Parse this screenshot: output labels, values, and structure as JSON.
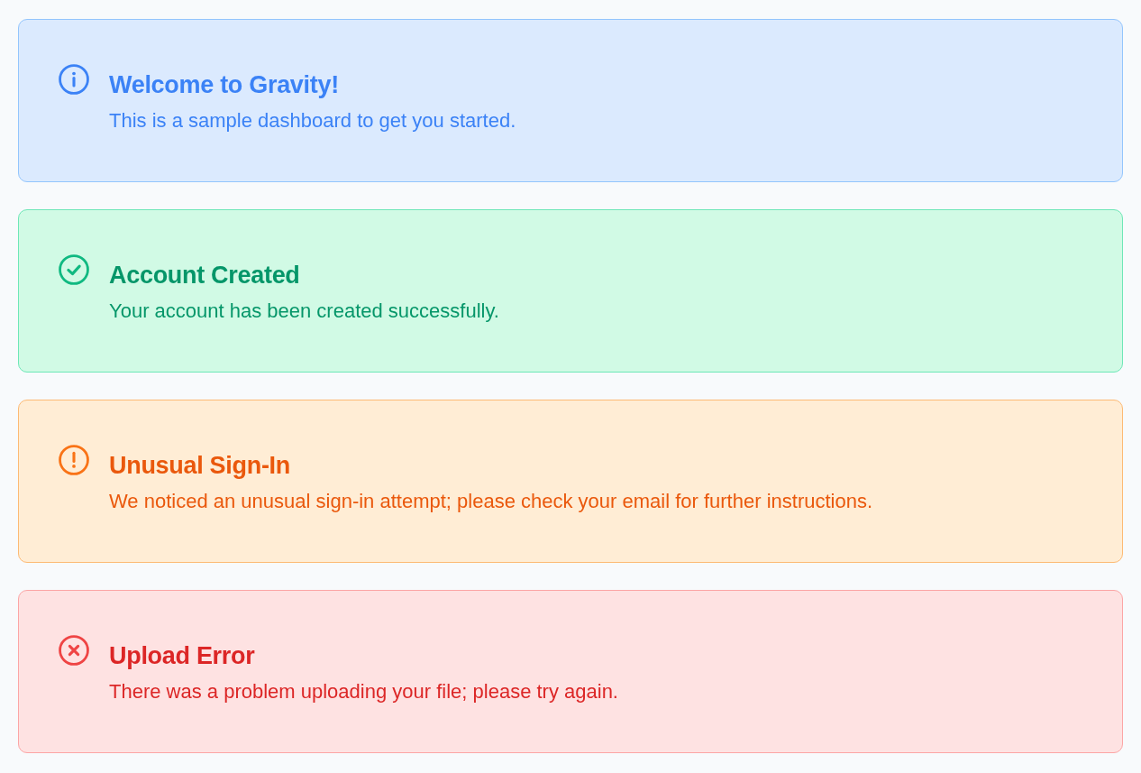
{
  "alerts": [
    {
      "kind": "info",
      "title": "Welcome to Gravity!",
      "message": "This is a sample dashboard to get you started."
    },
    {
      "kind": "success",
      "title": "Account Created",
      "message": "Your account has been created successfully."
    },
    {
      "kind": "warning",
      "title": "Unusual Sign-In",
      "message": "We noticed an unusual sign-in attempt; please check your email for further instructions."
    },
    {
      "kind": "error",
      "title": "Upload Error",
      "message": "There was a problem uploading your file; please try again."
    }
  ]
}
